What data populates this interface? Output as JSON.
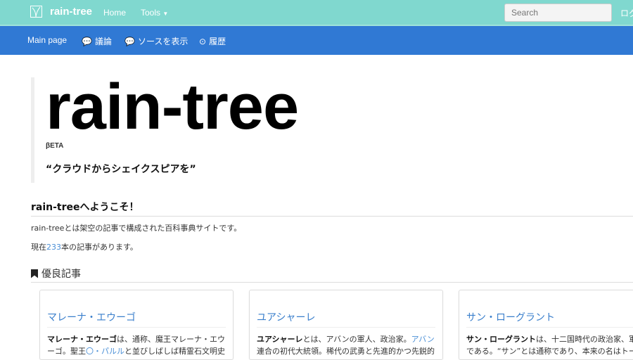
{
  "topbar": {
    "brand": "rain-tree",
    "home": "Home",
    "tools": "Tools",
    "search_placeholder": "Search",
    "login": "ログイン"
  },
  "subnav": {
    "main": "Main page",
    "talk": "議論",
    "source": "ソースを表示",
    "history": "履歴"
  },
  "hero": {
    "title": "rain-tree",
    "beta": "βETA",
    "quote": "“クラウドからシェイクスピアを”"
  },
  "welcome": {
    "heading": "rain-treeへようこそ！",
    "desc": "rain-treeとは架空の記事で構成された百科事典サイトです。",
    "count_pre": "現在",
    "count": "233",
    "count_post": "本の記事があります。"
  },
  "featured": {
    "heading": "優良記事",
    "cards": [
      {
        "title": "マレーナ・エウーゴ",
        "bold": "マレーナ・エウーゴ",
        "l1": "は、通称、魔王マレーナ・エウ",
        "l2a": "ーゴ。聖王",
        "link": "〇・パルル",
        "l2b": "と並びしばしば精霊石文明史"
      },
      {
        "title": "ユアシャーレ",
        "bold": "ユアシャーレ",
        "l1": "とは、アバンの軍人、政治家。",
        "link": "アバン",
        "l2": "連合の初代大統領。稀代の武勇と先進的かつ先鋭的"
      },
      {
        "title": "サン・ローグラント",
        "bold": "サン・ローグラント",
        "l1": "は、十二国時代の政治家、軍",
        "l2": "である。“サン”とは通称であり、本来の名はトー"
      }
    ]
  }
}
